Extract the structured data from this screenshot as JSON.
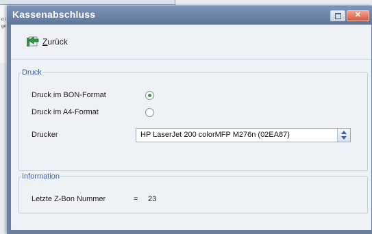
{
  "window": {
    "title": "Kassenabschluss",
    "titlebar_color": "#6b84aa",
    "close_color": "#d9593d"
  },
  "background_window": {
    "fragments": [
      "d l",
      "ge"
    ]
  },
  "toolbar": {
    "back_label_first": "Z",
    "back_label_rest": "urück",
    "back_icon": "back-arrow-icon"
  },
  "druck": {
    "legend": "Druck",
    "options": [
      {
        "label": "Druck im BON-Format",
        "selected": true
      },
      {
        "label": "Druck im A4-Format",
        "selected": false
      }
    ],
    "printer_label": "Drucker",
    "printer_value": "HP LaserJet 200 colorMFP M276n (02EA87)"
  },
  "information": {
    "legend": "Information",
    "label": "Letzte Z-Bon Nummer",
    "separator": "=",
    "value": "23"
  }
}
